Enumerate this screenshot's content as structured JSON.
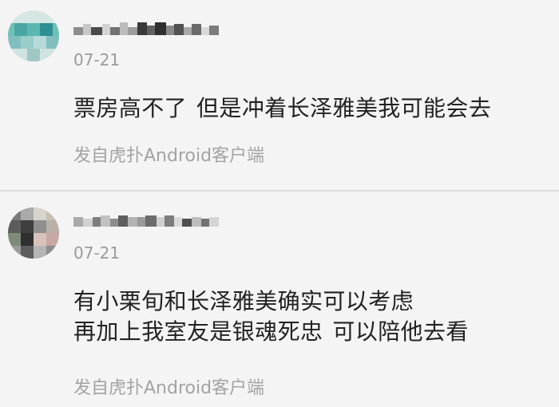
{
  "comments": [
    {
      "date": "07-21",
      "lines": [
        "票房高不了",
        "但是冲着长泽雅美我可能会去"
      ],
      "source": "发自虎扑Android客户端"
    },
    {
      "date": "07-21",
      "lines": [
        "有小栗旬和长泽雅美确实可以考虑",
        "再加上我室友是银魂死忠",
        "可以陪他去看"
      ],
      "source": "发自虎扑Android客户端"
    }
  ],
  "icons": {
    "avatar_1": "pixelated-avatar-icon",
    "avatar_2": "pixelated-avatar-icon"
  },
  "colors": {
    "background": "#f4f4f4",
    "text": "#222222",
    "meta_text": "#9a9a9a",
    "divider": "#dddddd"
  }
}
